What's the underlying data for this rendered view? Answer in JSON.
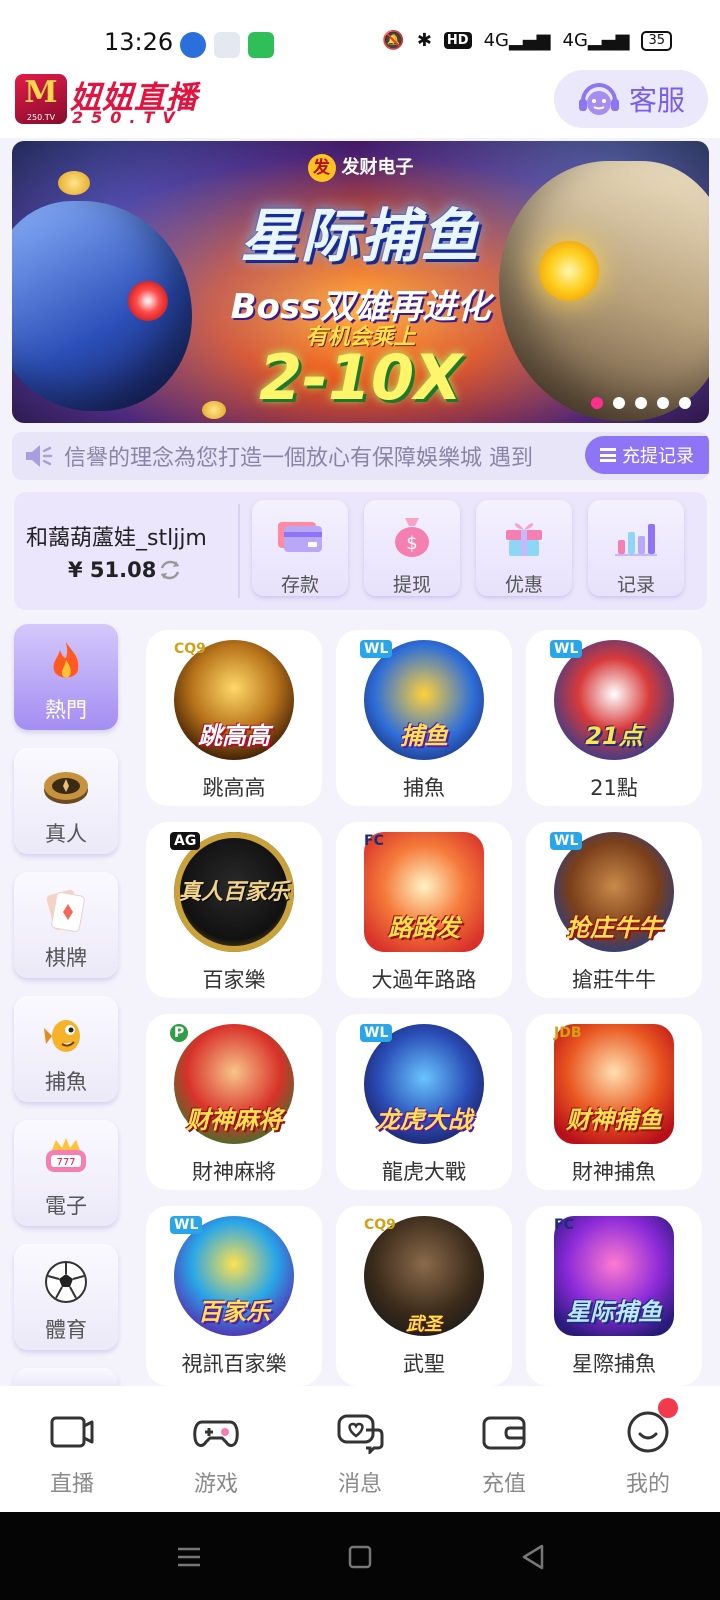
{
  "status_bar": {
    "time": "13:26",
    "hd_label": "HD",
    "signal1": "4G",
    "signal2": "4G",
    "battery": "35"
  },
  "header": {
    "logo_title": "妞妞直播",
    "logo_sub": "250.TV",
    "logo_badge": "250.TV",
    "service_label": "客服"
  },
  "banner": {
    "brand": "发财电子",
    "title": "星际捕鱼",
    "line1": "Boss双雄再进化",
    "line2": "有机会乘上",
    "line3": "2-10X",
    "slide_count": 5,
    "active_slide": 1
  },
  "notice": {
    "text": "信譽的理念為您打造一個放心有保障娛樂城  遇到",
    "records_label": "充提记录"
  },
  "account": {
    "username": "和藹葫蘆娃_stljjm",
    "balance": "¥ 51.08",
    "actions": [
      {
        "label": "存款",
        "icon": "card-icon"
      },
      {
        "label": "提现",
        "icon": "money-bag-icon"
      },
      {
        "label": "优惠",
        "icon": "gift-icon"
      },
      {
        "label": "记录",
        "icon": "bar-chart-icon"
      }
    ]
  },
  "categories": [
    {
      "label": "熱門",
      "icon": "flame-icon",
      "active": true
    },
    {
      "label": "真人",
      "icon": "chip-icon",
      "active": false
    },
    {
      "label": "棋牌",
      "icon": "playing-card-icon",
      "active": false
    },
    {
      "label": "捕魚",
      "icon": "fish-icon",
      "active": false
    },
    {
      "label": "電子",
      "icon": "slot-icon",
      "active": false
    },
    {
      "label": "體育",
      "icon": "soccer-ball-icon",
      "active": false
    }
  ],
  "games": [
    {
      "label": "跳高高",
      "badge": "CQ9",
      "art_text": "跳高高"
    },
    {
      "label": "捕魚",
      "badge": "WL",
      "art_text": "捕鱼"
    },
    {
      "label": "21點",
      "badge": "WL",
      "art_text": "21点"
    },
    {
      "label": "百家樂",
      "badge": "AG",
      "art_text": "真人百家乐"
    },
    {
      "label": "大過年路路",
      "badge": "FC",
      "art_text": "路路发"
    },
    {
      "label": "搶莊牛牛",
      "badge": "WL",
      "art_text": "抢庄牛牛"
    },
    {
      "label": "財神麻將",
      "badge": "P",
      "art_text": "财神麻将"
    },
    {
      "label": "龍虎大戰",
      "badge": "WL",
      "art_text": "龙虎大战"
    },
    {
      "label": "財神捕魚",
      "badge": "JDB",
      "art_text": "财神捕鱼"
    },
    {
      "label": "視訊百家樂",
      "badge": "WL",
      "art_text": "百家乐"
    },
    {
      "label": "武聖",
      "badge": "CQ9",
      "art_text": "武圣"
    },
    {
      "label": "星際捕魚",
      "badge": "FC",
      "art_text": "星际捕鱼"
    }
  ],
  "bottom_nav": [
    {
      "label": "直播",
      "icon": "camera-icon"
    },
    {
      "label": "游戏",
      "icon": "gamepad-icon"
    },
    {
      "label": "消息",
      "icon": "chat-heart-icon"
    },
    {
      "label": "充值",
      "icon": "wallet-icon"
    },
    {
      "label": "我的",
      "icon": "smile-icon",
      "has_badge": true
    }
  ],
  "colors": {
    "accent": "#8e75f5",
    "brand_red": "#e3123f",
    "badge_red": "#f23a4a",
    "page_bg": "#f4f2fb"
  }
}
